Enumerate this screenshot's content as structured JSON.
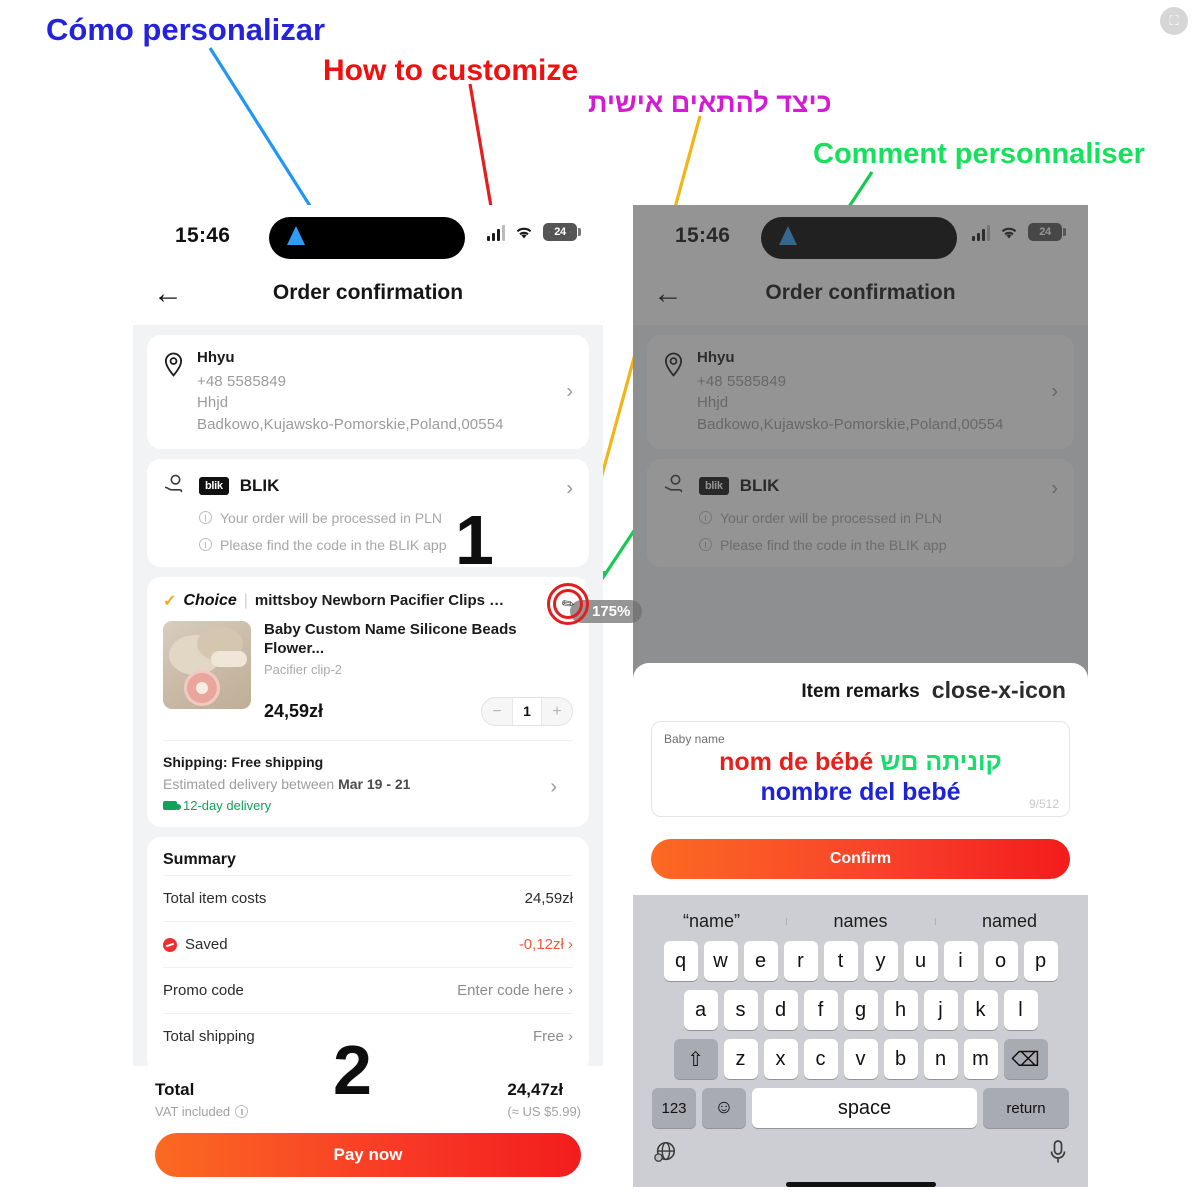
{
  "annotations": {
    "spanish": "Cómo personalizar",
    "english": "How to customize",
    "hebrew": "כיצד להתאים אישית",
    "french": "Comment personnaliser"
  },
  "steps": {
    "one": "1",
    "two": "2"
  },
  "zoom_badge": "175%",
  "watermark_icon": "image-expand-icon",
  "statusbar": {
    "time": "15:46",
    "battery": "24",
    "signal_icon": "cellular-signal-icon",
    "wifi_icon": "wifi-icon",
    "location_icon": "location-arrow-icon"
  },
  "left_phone": {
    "nav": {
      "back_icon": "back-arrow-icon",
      "title": "Order confirmation"
    },
    "address": {
      "pin_icon": "location-pin-icon",
      "name": "Hhyu",
      "phone": "+48 5585849",
      "line1": "Hhjd",
      "line2": "Badkowo,Kujawsko-Pomorskie,Poland,00554",
      "chevron": "›"
    },
    "payment": {
      "hand_icon": "hand-coin-icon",
      "logo_text": "blik",
      "name": "BLIK",
      "chevron": "›",
      "note1": "Your order will be processed in PLN",
      "note2": "Please find the code in the BLIK app"
    },
    "store": {
      "check_icon": "check-mark-icon",
      "badge": "Choice",
      "separator": "|",
      "name": "mittsboy Newborn Pacifier Clips Official St...",
      "edit_icon": "pencil-edit-icon"
    },
    "product": {
      "image_alt": "pacifier-clip-photo",
      "title": "Baby Custom Name Silicone Beads Flower...",
      "variant": "Pacifier clip-2",
      "price": "24,59zł",
      "minus": "−",
      "qty": "1",
      "plus": "+"
    },
    "shipping": {
      "head": "Shipping: Free shipping",
      "estimate_prefix": "Estimated delivery between ",
      "estimate_dates": "Mar 19 - 21",
      "fast": "12-day delivery",
      "truck_icon": "delivery-truck-icon",
      "chevron": "›"
    },
    "summary": {
      "title": "Summary",
      "rows": [
        {
          "label": "Total item costs",
          "value": "24,59zł",
          "style": "plain",
          "icon": ""
        },
        {
          "label": "Saved",
          "value": "-0,12zł ›",
          "style": "accent",
          "icon": "discount-icon"
        },
        {
          "label": "Promo code",
          "value": "Enter code here ›",
          "style": "muted",
          "icon": ""
        },
        {
          "label": "Total shipping",
          "value": "Free ›",
          "style": "muted",
          "icon": ""
        }
      ]
    },
    "total": {
      "label": "Total",
      "vat": "VAT included",
      "vat_icon": "info-circle-icon",
      "amount": "24,47zł",
      "usd": "(≈ US $5.99)",
      "cta": "Pay now"
    }
  },
  "right_phone": {
    "nav": {
      "back_icon": "back-arrow-icon",
      "title": "Order confirmation"
    },
    "address": {
      "pin_icon": "location-pin-icon",
      "name": "Hhyu",
      "phone": "+48 5585849",
      "line1": "Hhjd",
      "line2": "Badkowo,Kujawsko-Pomorskie,Poland,00554",
      "chevron": "›"
    },
    "payment": {
      "hand_icon": "hand-coin-icon",
      "logo_text": "blik",
      "name": "BLIK",
      "chevron": "›",
      "note1": "Your order will be processed in PLN",
      "note2": "Please find the code in the BLIK app"
    },
    "sheet": {
      "title": "Item remarks",
      "close_icon": "close-x-icon",
      "field_label": "Baby name",
      "text_fr": "nom de bébé",
      "text_he": "קוניתה םש",
      "text_es": "nombre del bebé",
      "char_count": "9/512",
      "confirm": "Confirm"
    },
    "keyboard": {
      "suggestions": [
        "“name”",
        "names",
        "named"
      ],
      "row1": [
        "q",
        "w",
        "e",
        "r",
        "t",
        "y",
        "u",
        "i",
        "o",
        "p"
      ],
      "row2": [
        "a",
        "s",
        "d",
        "f",
        "g",
        "h",
        "j",
        "k",
        "l"
      ],
      "row3": [
        "z",
        "x",
        "c",
        "v",
        "b",
        "n",
        "m"
      ],
      "shift_icon": "shift-arrow-icon",
      "backspace_icon": "backspace-icon",
      "numbers_key": "123",
      "emoji_icon": "emoji-smiley-icon",
      "space_key": "space",
      "return_key": "return",
      "globe_icon": "globe-language-icon",
      "mic_icon": "microphone-icon"
    }
  }
}
